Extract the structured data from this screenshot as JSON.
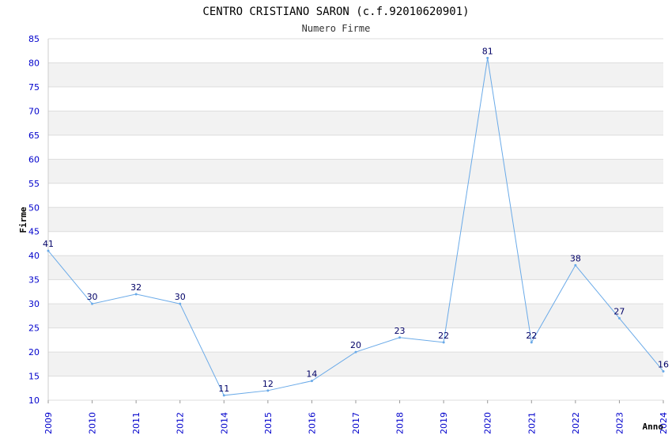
{
  "chart_data": {
    "type": "line",
    "title": "CENTRO CRISTIANO SARON (c.f.92010620901)",
    "subtitle": "Numero Firme",
    "xlabel": "Anno",
    "ylabel": "Firme",
    "x": [
      "2009",
      "2010",
      "2011",
      "2012",
      "2014",
      "2015",
      "2016",
      "2017",
      "2018",
      "2019",
      "2020",
      "2021",
      "2022",
      "2023",
      "2024"
    ],
    "values": [
      41,
      30,
      32,
      30,
      11,
      12,
      14,
      20,
      23,
      22,
      81,
      22,
      38,
      27,
      16
    ],
    "ylim": [
      10,
      85
    ],
    "yticks": [
      10,
      15,
      20,
      25,
      30,
      35,
      40,
      45,
      50,
      55,
      60,
      65,
      70,
      75,
      80,
      85
    ],
    "grid": "horizontal bands",
    "colors": {
      "line": "#6aaae8",
      "band": "#f2f2f2",
      "gridline": "#dddddd",
      "tick_text": "#0000cc",
      "data_label": "#000066"
    }
  }
}
